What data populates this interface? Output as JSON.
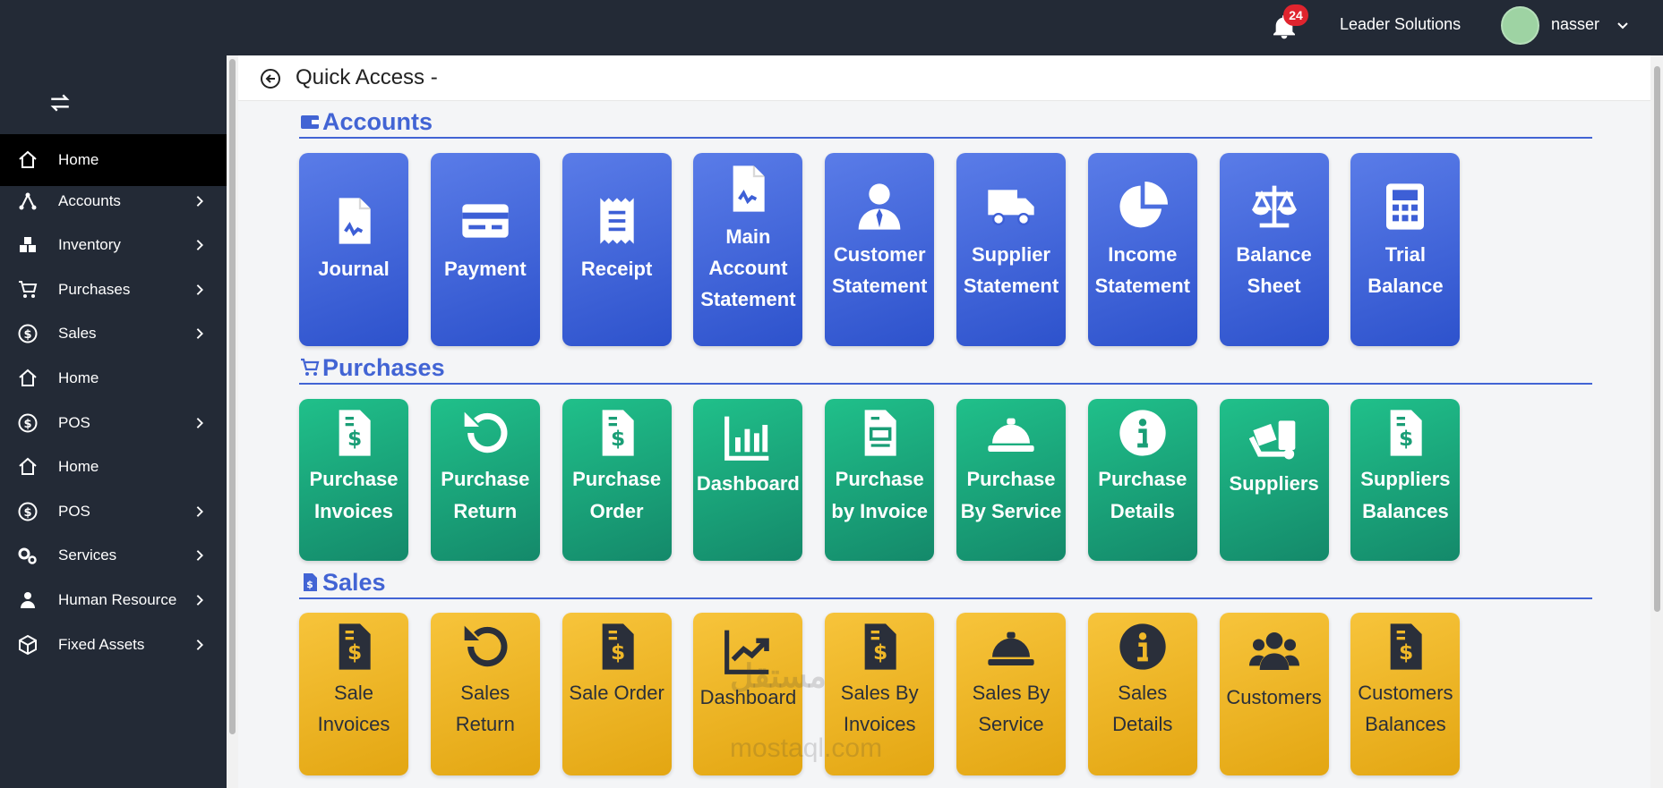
{
  "topbar": {
    "notification_count": "24",
    "company": "Leader Solutions",
    "username": "nasser"
  },
  "sidebar": {
    "items": [
      {
        "label": "Home",
        "icon": "home-icon",
        "active": true,
        "chevron": false
      },
      {
        "label": "Accounts",
        "icon": "accounts-icon",
        "chevron": true
      },
      {
        "label": "Inventory",
        "icon": "inventory-icon",
        "chevron": true
      },
      {
        "label": "Purchases",
        "icon": "cart-icon",
        "chevron": true
      },
      {
        "label": "Sales",
        "icon": "dollar-icon",
        "chevron": true
      },
      {
        "label": "Home",
        "icon": "home-icon",
        "chevron": false
      },
      {
        "label": "POS",
        "icon": "dollar-icon",
        "chevron": true
      },
      {
        "label": "Home",
        "icon": "home-icon",
        "chevron": false
      },
      {
        "label": "POS",
        "icon": "dollar-icon",
        "chevron": true
      },
      {
        "label": "Services",
        "icon": "gears-icon",
        "chevron": true
      },
      {
        "label": "Human Resource",
        "icon": "user-icon",
        "chevron": true
      },
      {
        "label": "Fixed Assets",
        "icon": "box-icon",
        "chevron": true
      }
    ]
  },
  "page": {
    "title": "Quick Access -"
  },
  "sections": {
    "accounts": {
      "title": "Accounts",
      "tiles": [
        {
          "label": "Journal",
          "icon": "file-signature-icon"
        },
        {
          "label": "Payment",
          "icon": "credit-card-icon"
        },
        {
          "label": "Receipt",
          "icon": "receipt-icon"
        },
        {
          "label": "Main Account Statement",
          "icon": "file-signature-icon"
        },
        {
          "label": "Customer Statement",
          "icon": "user-tie-icon"
        },
        {
          "label": "Supplier Statement",
          "icon": "truck-icon"
        },
        {
          "label": "Income Statement",
          "icon": "pie-chart-icon"
        },
        {
          "label": "Balance Sheet",
          "icon": "scale-icon"
        },
        {
          "label": "Trial Balance",
          "icon": "calculator-icon"
        }
      ]
    },
    "purchases": {
      "title": "Purchases",
      "tiles": [
        {
          "label": "Purchase Invoices",
          "icon": "file-invoice-dollar-icon"
        },
        {
          "label": "Purchase Return",
          "icon": "undo-icon"
        },
        {
          "label": "Purchase Order",
          "icon": "file-invoice-dollar-icon"
        },
        {
          "label": "Dashboard",
          "icon": "bar-chart-icon"
        },
        {
          "label": "Purchase by Invoice",
          "icon": "file-invoice-icon"
        },
        {
          "label": "Purchase By Service",
          "icon": "concierge-bell-icon"
        },
        {
          "label": "Purchase Details",
          "icon": "info-circle-icon"
        },
        {
          "label": "Suppliers",
          "icon": "dolly-icon"
        },
        {
          "label": "Suppliers Balances",
          "icon": "file-invoice-dollar-icon"
        }
      ]
    },
    "sales": {
      "title": "Sales",
      "tiles": [
        {
          "label": "Sale Invoices",
          "icon": "file-invoice-dollar-icon"
        },
        {
          "label": "Sales Return",
          "icon": "undo-icon"
        },
        {
          "label": "Sale Order",
          "icon": "file-invoice-dollar-icon"
        },
        {
          "label": "Dashboard",
          "icon": "line-chart-icon"
        },
        {
          "label": "Sales By Invoices",
          "icon": "file-invoice-dollar-icon"
        },
        {
          "label": "Sales By Service",
          "icon": "concierge-bell-icon"
        },
        {
          "label": "Sales Details",
          "icon": "info-circle-icon"
        },
        {
          "label": "Customers",
          "icon": "users-icon"
        },
        {
          "label": "Customers Balances",
          "icon": "file-invoice-dollar-icon"
        }
      ]
    }
  },
  "watermark": {
    "arabic": "مستقل",
    "latin": "mostaql.com"
  },
  "colors": {
    "topbar": "#232a36",
    "accent": "#4264d4",
    "blue_tile": "#3b5fd8",
    "green_tile": "#1aa57a",
    "yellow_tile": "#f0b828"
  }
}
